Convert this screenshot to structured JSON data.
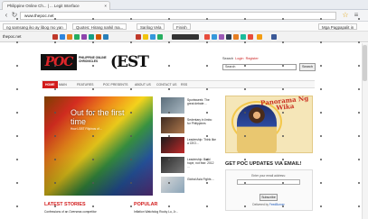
{
  "browser": {
    "tab_title": "Philippine Online Ch... | ... Legit Interface",
    "address": "www.thepoc.net",
    "bookmarks": [
      "ng samsang iko ay libog mo yan",
      "Quotes: Hirang narkil ma...",
      "Sarilog Vela",
      "Finish",
      "Mga Pagpapalit in"
    ],
    "toolbar_left": "thepoc.net"
  },
  "site": {
    "logo": "POC",
    "logo_sub": "Philippine Online Chronicles",
    "logo_est": "(EST",
    "search_label": "Search",
    "login": "Login",
    "register": "Register",
    "search_placeholder": "Search",
    "search_button": "Search"
  },
  "nav": [
    "HOME",
    "MAIN",
    "FEATURES",
    "POC PRESENTS",
    "ABOUT US",
    "CONTACT US",
    "RSS"
  ],
  "hero": {
    "title": "Out for the first time",
    "subtitle": "How LGBT Filipinos of ..."
  },
  "side_stories": [
    {
      "text": "Sportsweek: The great debate ..."
    },
    {
      "text": "Sedentary in limbo for Philippines"
    },
    {
      "text": "Leadership: Think like a CEO..."
    },
    {
      "text": "Leadership: Build hope, not fear: 2012 ..."
    },
    {
      "text": "Global Asia Fights ..."
    }
  ],
  "ad": {
    "title": "Panorama Ng Wika"
  },
  "subscribe": {
    "heading": "GET POC UPDATES VIA EMAIL!",
    "label": "Enter your email address:",
    "button": "Subscribe",
    "delivered_by": "Delivered by",
    "provider": "FeedBurner"
  },
  "latest": {
    "heading": "LATEST STORIES",
    "item": "Confessions of an Overseas competitor"
  },
  "popular": {
    "heading": "POPULAR",
    "item": "Inflation Watchdog Rocky Lu, Jr..."
  }
}
